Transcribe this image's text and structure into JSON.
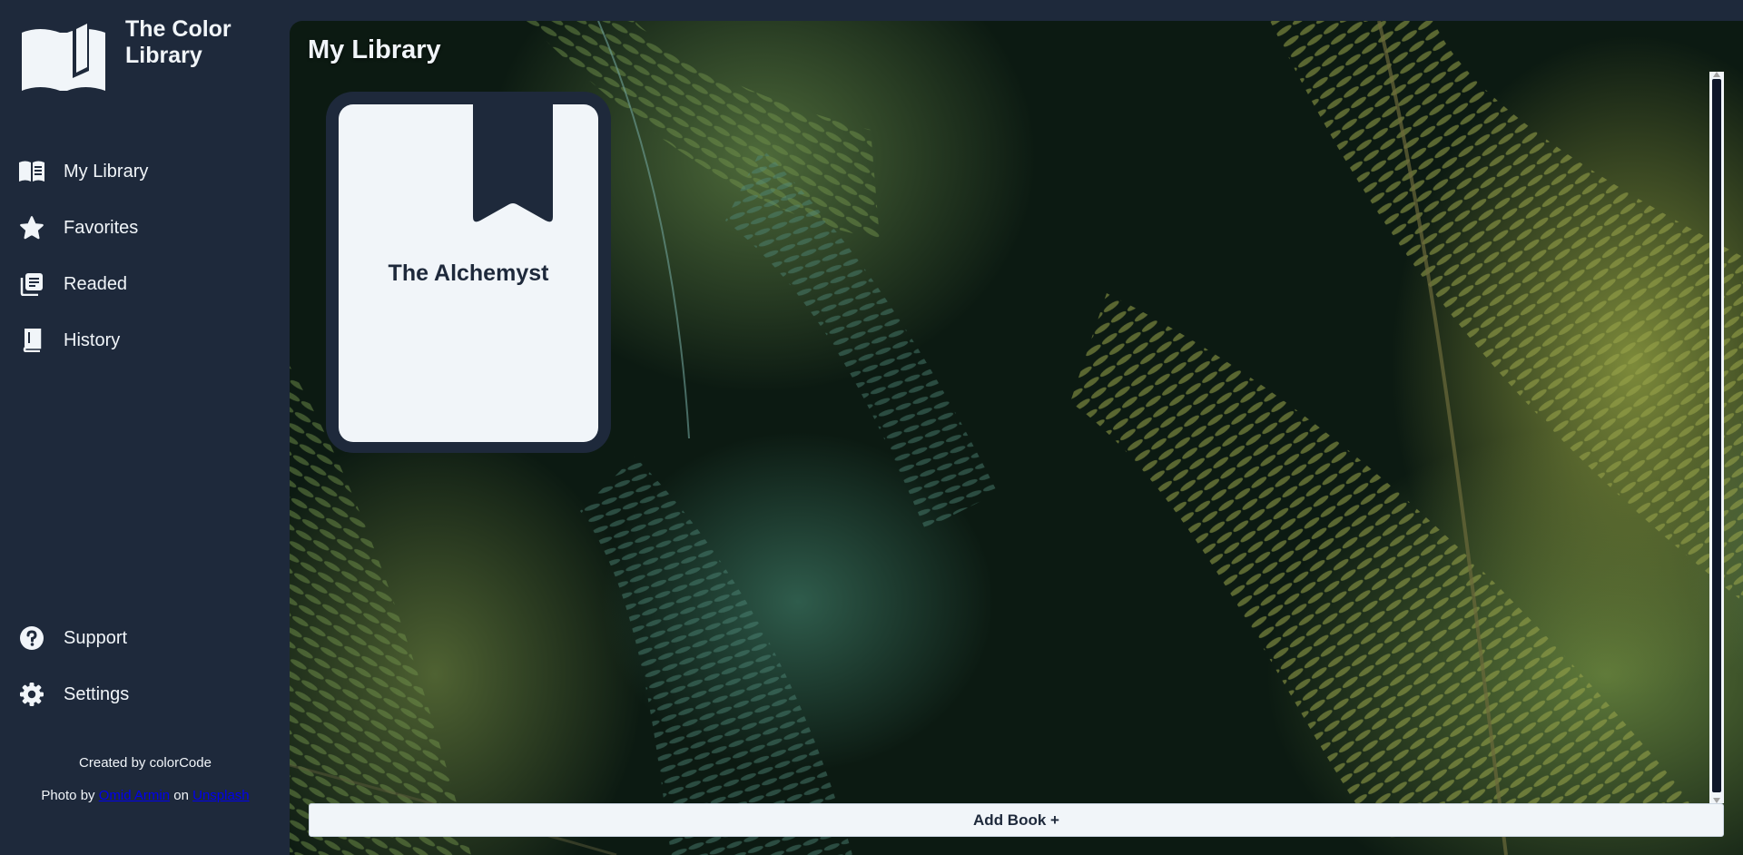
{
  "brand": {
    "title": "The Color Library",
    "logo_icon": "open-book-logo-icon"
  },
  "sidebar": {
    "items": [
      {
        "label": "My Library",
        "icon": "library-book-icon"
      },
      {
        "label": "Favorites",
        "icon": "star-icon"
      },
      {
        "label": "Readed",
        "icon": "reading-list-icon"
      },
      {
        "label": "History",
        "icon": "book-history-icon"
      }
    ],
    "bottom_items": [
      {
        "label": "Support",
        "icon": "question-circle-icon"
      },
      {
        "label": "Settings",
        "icon": "gear-icon"
      }
    ],
    "credits": {
      "created_by": "Created by colorCode",
      "photo_prefix": "Photo by",
      "photographer": "Omid Armin",
      "on_text": "on",
      "site": "Unsplash"
    }
  },
  "main": {
    "title": "My Library",
    "books": [
      {
        "title": "The Alchemyst"
      }
    ],
    "add_button": "Add Book +"
  },
  "colors": {
    "sidebar_bg": "#1e293b",
    "card_bg": "#f1f5f9",
    "text_light": "#f1f5f9",
    "text_dark": "#1e293b",
    "link": "#0000ee"
  }
}
